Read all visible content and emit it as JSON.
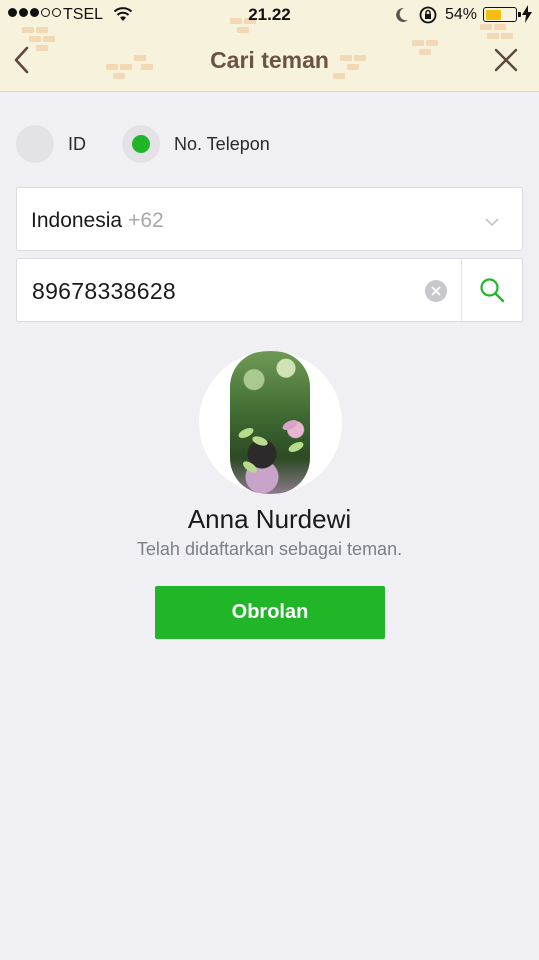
{
  "status_bar": {
    "carrier": "TSEL",
    "time": "21.22",
    "battery_percent": "54%",
    "battery_level": 0.54,
    "signal_bars_filled": 3,
    "signal_bars_total": 5
  },
  "header": {
    "title": "Cari teman",
    "back_icon": "chevron-left-icon",
    "close_icon": "close-icon"
  },
  "search_mode": {
    "options": [
      {
        "label": "ID",
        "selected": false
      },
      {
        "label": "No. Telepon",
        "selected": true
      }
    ]
  },
  "country": {
    "name": "Indonesia",
    "code": "+62"
  },
  "phone_input": {
    "value": "89678338628"
  },
  "result": {
    "name": "Anna Nurdewi",
    "status": "Telah didaftarkan sebagai teman.",
    "chat_button": "Obrolan"
  },
  "colors": {
    "accent": "#21b628",
    "header_bg": "#f7f2dc",
    "header_title": "#6b5440",
    "page_bg": "#efeff4",
    "battery": "#f3c012"
  }
}
